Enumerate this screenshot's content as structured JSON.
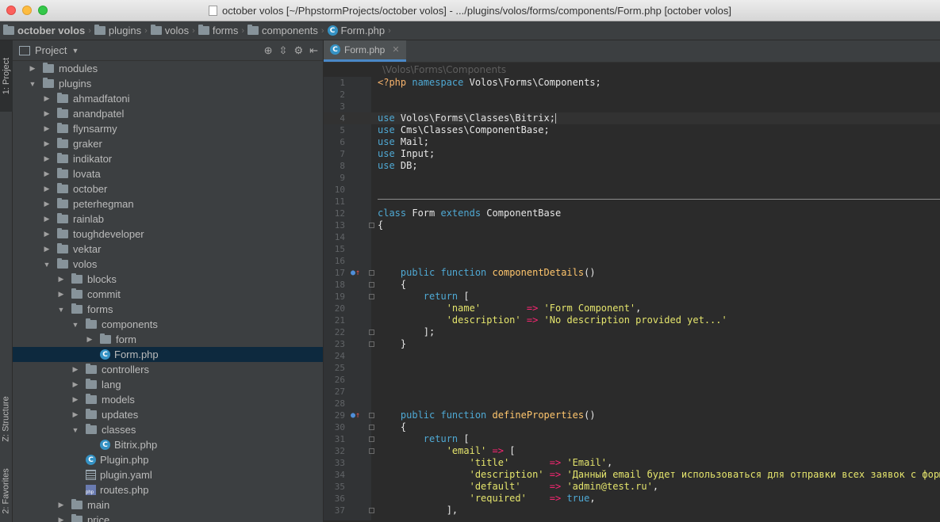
{
  "window": {
    "title": "october volos [~/PhpstormProjects/october volos] - .../plugins/volos/forms/components/Form.php [october volos]"
  },
  "breadcrumbs": [
    "october volos",
    "plugins",
    "volos",
    "forms",
    "components",
    "Form.php"
  ],
  "toolstrip": {
    "project_tab": "1: Project",
    "structure_tab": "Z: Structure",
    "favorites_tab": "2: Favorites"
  },
  "project_panel": {
    "title": "Project",
    "tree": [
      {
        "label": "modules",
        "depth": 1,
        "kind": "folder",
        "state": "collapsed"
      },
      {
        "label": "plugins",
        "depth": 1,
        "kind": "folder",
        "state": "expanded"
      },
      {
        "label": "ahmadfatoni",
        "depth": 2,
        "kind": "folder",
        "state": "collapsed"
      },
      {
        "label": "anandpatel",
        "depth": 2,
        "kind": "folder",
        "state": "collapsed"
      },
      {
        "label": "flynsarmy",
        "depth": 2,
        "kind": "folder",
        "state": "collapsed"
      },
      {
        "label": "graker",
        "depth": 2,
        "kind": "folder",
        "state": "collapsed"
      },
      {
        "label": "indikator",
        "depth": 2,
        "kind": "folder",
        "state": "collapsed"
      },
      {
        "label": "lovata",
        "depth": 2,
        "kind": "folder",
        "state": "collapsed"
      },
      {
        "label": "october",
        "depth": 2,
        "kind": "folder",
        "state": "collapsed"
      },
      {
        "label": "peterhegman",
        "depth": 2,
        "kind": "folder",
        "state": "collapsed"
      },
      {
        "label": "rainlab",
        "depth": 2,
        "kind": "folder",
        "state": "collapsed"
      },
      {
        "label": "toughdeveloper",
        "depth": 2,
        "kind": "folder",
        "state": "collapsed"
      },
      {
        "label": "vektar",
        "depth": 2,
        "kind": "folder",
        "state": "collapsed"
      },
      {
        "label": "volos",
        "depth": 2,
        "kind": "folder",
        "state": "expanded"
      },
      {
        "label": "blocks",
        "depth": 3,
        "kind": "folder",
        "state": "collapsed"
      },
      {
        "label": "commit",
        "depth": 3,
        "kind": "folder",
        "state": "collapsed"
      },
      {
        "label": "forms",
        "depth": 3,
        "kind": "folder",
        "state": "expanded"
      },
      {
        "label": "components",
        "depth": 4,
        "kind": "folder",
        "state": "expanded"
      },
      {
        "label": "form",
        "depth": 5,
        "kind": "folder",
        "state": "collapsed"
      },
      {
        "label": "Form.php",
        "depth": 5,
        "kind": "class",
        "state": "leaf",
        "selected": true
      },
      {
        "label": "controllers",
        "depth": 4,
        "kind": "folder",
        "state": "collapsed"
      },
      {
        "label": "lang",
        "depth": 4,
        "kind": "folder",
        "state": "collapsed"
      },
      {
        "label": "models",
        "depth": 4,
        "kind": "folder",
        "state": "collapsed"
      },
      {
        "label": "updates",
        "depth": 4,
        "kind": "folder",
        "state": "collapsed"
      },
      {
        "label": "classes",
        "depth": 4,
        "kind": "folder",
        "state": "expanded"
      },
      {
        "label": "Bitrix.php",
        "depth": 5,
        "kind": "class",
        "state": "leaf"
      },
      {
        "label": "Plugin.php",
        "depth": 4,
        "kind": "class",
        "state": "leaf"
      },
      {
        "label": "plugin.yaml",
        "depth": 4,
        "kind": "yaml",
        "state": "leaf"
      },
      {
        "label": "routes.php",
        "depth": 4,
        "kind": "php",
        "state": "leaf"
      },
      {
        "label": "main",
        "depth": 3,
        "kind": "folder",
        "state": "collapsed"
      },
      {
        "label": "price",
        "depth": 3,
        "kind": "folder",
        "state": "collapsed"
      }
    ]
  },
  "editor": {
    "tab_label": "Form.php",
    "namespace_breadcrumb": "\\Volos\\Forms\\Components",
    "current_line": 4,
    "lines": [
      {
        "n": "1",
        "tokens": [
          [
            "php-tag",
            "<?php "
          ],
          [
            "kw2",
            "namespace "
          ],
          [
            "plain",
            "Volos\\Forms\\Components;"
          ]
        ]
      },
      {
        "n": "2",
        "tokens": []
      },
      {
        "n": "3",
        "tokens": []
      },
      {
        "n": "4",
        "tokens": [
          [
            "kw2",
            "use "
          ],
          [
            "plain",
            "Volos\\Forms\\Classes\\Bitrix;"
          ]
        ],
        "cursor": true
      },
      {
        "n": "5",
        "tokens": [
          [
            "kw2",
            "use "
          ],
          [
            "plain",
            "Cms\\Classes\\ComponentBase;"
          ]
        ]
      },
      {
        "n": "6",
        "tokens": [
          [
            "kw2",
            "use "
          ],
          [
            "plain",
            "Mail;"
          ]
        ]
      },
      {
        "n": "7",
        "tokens": [
          [
            "kw2",
            "use "
          ],
          [
            "plain",
            "Input;"
          ]
        ]
      },
      {
        "n": "8",
        "tokens": [
          [
            "kw2",
            "use "
          ],
          [
            "plain",
            "DB;"
          ]
        ]
      },
      {
        "n": "9",
        "tokens": []
      },
      {
        "n": "10",
        "tokens": []
      },
      {
        "n": "11",
        "tokens": [],
        "separator": true
      },
      {
        "n": "12",
        "tokens": [
          [
            "kw2",
            "class "
          ],
          [
            "plain",
            "Form "
          ],
          [
            "kw2",
            "extends "
          ],
          [
            "plain",
            "ComponentBase"
          ]
        ]
      },
      {
        "n": "13",
        "tokens": [
          [
            "plain",
            "{"
          ]
        ]
      },
      {
        "n": "14",
        "tokens": []
      },
      {
        "n": "15",
        "tokens": []
      },
      {
        "n": "16",
        "tokens": []
      },
      {
        "n": "17",
        "tokens": [
          [
            "plain",
            "    "
          ],
          [
            "kw2",
            "public "
          ],
          [
            "kw2",
            "function "
          ],
          [
            "fn",
            "componentDetails"
          ],
          [
            "plain",
            "()"
          ]
        ],
        "marker": true
      },
      {
        "n": "18",
        "tokens": [
          [
            "plain",
            "    {"
          ]
        ]
      },
      {
        "n": "19",
        "tokens": [
          [
            "plain",
            "        "
          ],
          [
            "kw2",
            "return "
          ],
          [
            "plain",
            "["
          ]
        ]
      },
      {
        "n": "20",
        "tokens": [
          [
            "plain",
            "            "
          ],
          [
            "str",
            "'name'"
          ],
          [
            "plain",
            "        "
          ],
          [
            "op",
            "=> "
          ],
          [
            "str",
            "'Form Component'"
          ],
          [
            "plain",
            ","
          ]
        ]
      },
      {
        "n": "21",
        "tokens": [
          [
            "plain",
            "            "
          ],
          [
            "str",
            "'description'"
          ],
          [
            "plain",
            " "
          ],
          [
            "op",
            "=> "
          ],
          [
            "str",
            "'No description provided yet...'"
          ]
        ]
      },
      {
        "n": "22",
        "tokens": [
          [
            "plain",
            "        ];"
          ]
        ]
      },
      {
        "n": "23",
        "tokens": [
          [
            "plain",
            "    }"
          ]
        ]
      },
      {
        "n": "24",
        "tokens": []
      },
      {
        "n": "25",
        "tokens": []
      },
      {
        "n": "26",
        "tokens": []
      },
      {
        "n": "27",
        "tokens": []
      },
      {
        "n": "28",
        "tokens": []
      },
      {
        "n": "29",
        "tokens": [
          [
            "plain",
            "    "
          ],
          [
            "kw2",
            "public "
          ],
          [
            "kw2",
            "function "
          ],
          [
            "fn",
            "defineProperties"
          ],
          [
            "plain",
            "()"
          ]
        ],
        "marker": true
      },
      {
        "n": "30",
        "tokens": [
          [
            "plain",
            "    {"
          ]
        ]
      },
      {
        "n": "31",
        "tokens": [
          [
            "plain",
            "        "
          ],
          [
            "kw2",
            "return "
          ],
          [
            "plain",
            "["
          ]
        ]
      },
      {
        "n": "32",
        "tokens": [
          [
            "plain",
            "            "
          ],
          [
            "str",
            "'email'"
          ],
          [
            "plain",
            " "
          ],
          [
            "op",
            "=> "
          ],
          [
            "plain",
            "["
          ]
        ]
      },
      {
        "n": "33",
        "tokens": [
          [
            "plain",
            "                "
          ],
          [
            "str",
            "'title'"
          ],
          [
            "plain",
            "       "
          ],
          [
            "op",
            "=> "
          ],
          [
            "str",
            "'Email'"
          ],
          [
            "plain",
            ","
          ]
        ]
      },
      {
        "n": "34",
        "tokens": [
          [
            "plain",
            "                "
          ],
          [
            "str",
            "'description'"
          ],
          [
            "plain",
            " "
          ],
          [
            "op",
            "=> "
          ],
          [
            "str",
            "'Данный email будет использоваться для отправки всех заявок с формы."
          ]
        ]
      },
      {
        "n": "35",
        "tokens": [
          [
            "plain",
            "                "
          ],
          [
            "str",
            "'default'"
          ],
          [
            "plain",
            "     "
          ],
          [
            "op",
            "=> "
          ],
          [
            "str",
            "'admin@test.ru'"
          ],
          [
            "plain",
            ","
          ]
        ]
      },
      {
        "n": "36",
        "tokens": [
          [
            "plain",
            "                "
          ],
          [
            "str",
            "'required'"
          ],
          [
            "plain",
            "    "
          ],
          [
            "op",
            "=> "
          ],
          [
            "kw2",
            "true"
          ],
          [
            "plain",
            ","
          ]
        ]
      },
      {
        "n": "37",
        "tokens": [
          [
            "plain",
            "            ],"
          ]
        ]
      }
    ]
  },
  "colors": {
    "background": "#2b2b2b",
    "panel": "#3c3f41",
    "selection": "#0d293e",
    "keyword": "#4fa9d4",
    "string": "#e4e46c",
    "function": "#ffc66d",
    "arrow_operator": "#f92672"
  },
  "icons": {
    "folder": "folder-icon",
    "class_file": "php-class-icon",
    "yaml_file": "yaml-file-icon",
    "php_file": "php-file-icon"
  }
}
